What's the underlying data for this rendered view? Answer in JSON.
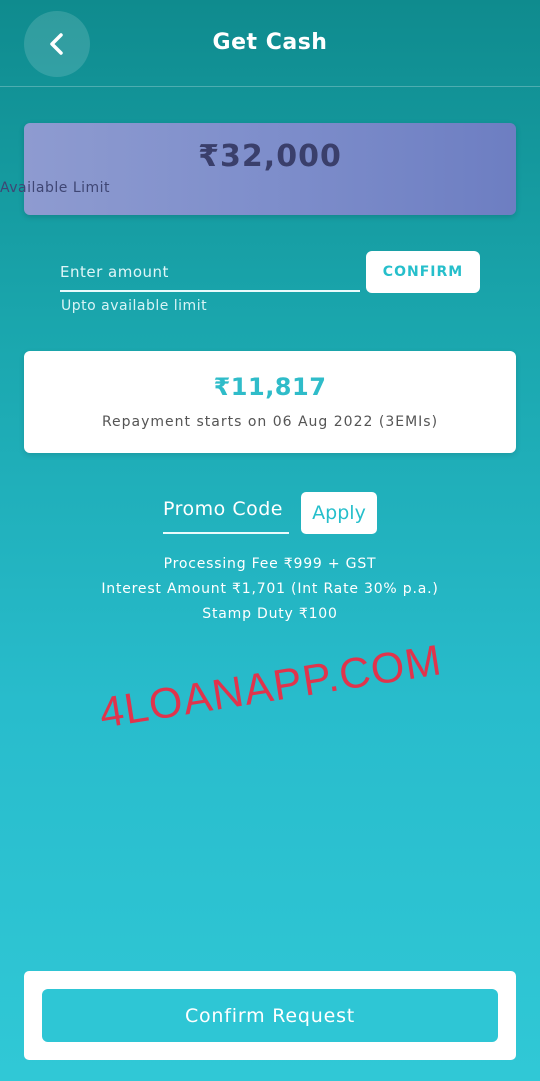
{
  "header": {
    "title": "Get Cash",
    "back_icon": "chevron-left-icon"
  },
  "limit_card": {
    "amount": "₹32,000",
    "label": "Available Limit"
  },
  "amount_entry": {
    "placeholder": "Enter amount",
    "value": "",
    "confirm_label": "CONFIRM",
    "helper": "Upto available limit"
  },
  "repayment": {
    "amount": "₹11,817",
    "text": "Repayment starts on 06 Aug 2022 (3EMIs)"
  },
  "promo": {
    "label": "Promo Code",
    "apply_label": "Apply"
  },
  "fees": {
    "processing": "Processing Fee ₹999 + GST",
    "interest": "Interest Amount ₹1,701 (Int Rate 30% p.a.)",
    "stamp": "Stamp Duty ₹100"
  },
  "watermark": "4LOANAPP.COM",
  "footer": {
    "confirm_request_label": "Confirm Request"
  },
  "colors": {
    "accent": "#2ec6d5",
    "header_bg": "#0f8b8e",
    "limit_card": "#7e8ecb",
    "watermark": "#e0344c"
  }
}
